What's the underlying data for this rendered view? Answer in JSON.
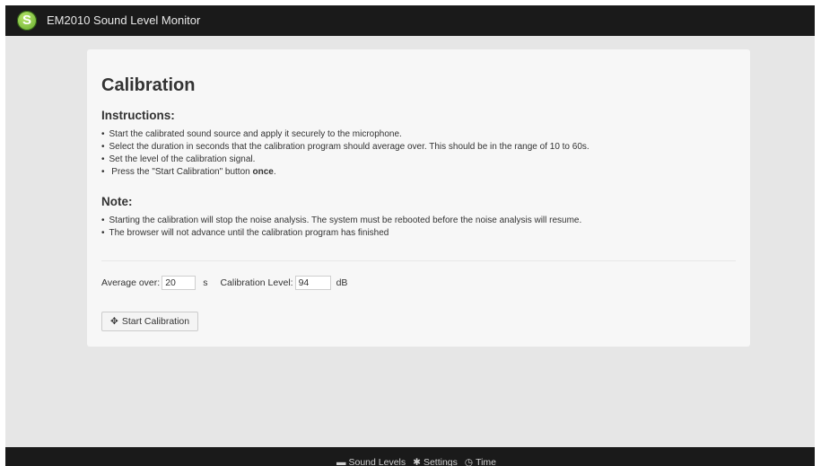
{
  "header": {
    "logo_glyph": "S",
    "title": "EM2010 Sound Level Monitor"
  },
  "main": {
    "page_title": "Calibration",
    "instructions_heading": "Instructions:",
    "instructions": [
      "Start the calibrated sound source and apply it securely to the microphone.",
      "Select the duration in seconds that the calibration program should average over. This should be in the range of 10 to 60s.",
      "Set the level of the calibration signal."
    ],
    "instruction_press_prefix": "Press the \"Start Calibration\" button ",
    "instruction_press_bold": "once",
    "instruction_press_suffix": ".",
    "note_heading": "Note:",
    "notes": [
      "Starting the calibration will stop the noise analysis. The system must be rebooted before the noise analysis will resume.",
      "The browser will not advance until the calibration program has finished"
    ],
    "form": {
      "average_label": "Average over:",
      "average_value": "20",
      "average_unit": "s",
      "level_label": "Calibration Level:",
      "level_value": "94",
      "level_unit": "dB"
    },
    "start_button": {
      "icon": "✥",
      "label": "Start Calibration"
    }
  },
  "footer": {
    "links": [
      {
        "icon": "folder-open-icon",
        "glyph": "▬",
        "label": "Sound Levels"
      },
      {
        "icon": "gear-icon",
        "glyph": "✱",
        "label": "Settings"
      },
      {
        "icon": "clock-icon",
        "glyph": "◷",
        "label": "Time"
      }
    ]
  },
  "colors": {
    "navbar_bg": "#1a1a1a",
    "page_bg": "#e6e6e6",
    "panel_bg": "#f7f7f7",
    "logo_green": "#7ec242"
  }
}
